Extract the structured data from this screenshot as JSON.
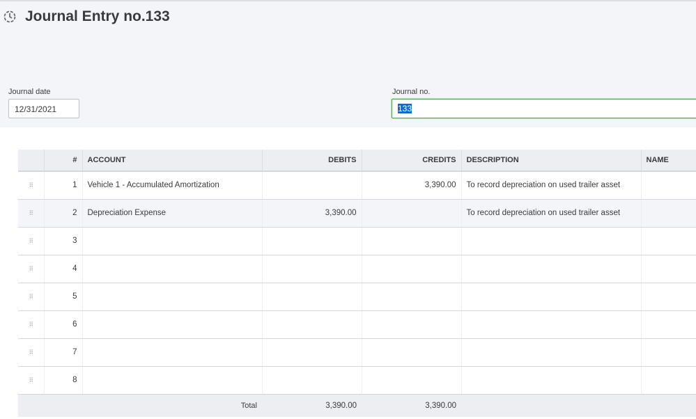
{
  "header": {
    "title": "Journal Entry no.133"
  },
  "form": {
    "date_label": "Journal date",
    "date_value": "12/31/2021",
    "no_label": "Journal no.",
    "no_value": "133"
  },
  "table": {
    "columns": [
      "#",
      "ACCOUNT",
      "DEBITS",
      "CREDITS",
      "DESCRIPTION",
      "NAME"
    ],
    "rows": [
      {
        "n": "1",
        "account": "Vehicle 1 - Accumulated Amortization",
        "debit": "",
        "credit": "3,390.00",
        "desc": "To record depreciation on used trailer asset",
        "name": ""
      },
      {
        "n": "2",
        "account": "Depreciation Expense",
        "debit": "3,390.00",
        "credit": "",
        "desc": "To record depreciation on used trailer asset",
        "name": ""
      },
      {
        "n": "3",
        "account": "",
        "debit": "",
        "credit": "",
        "desc": "",
        "name": ""
      },
      {
        "n": "4",
        "account": "",
        "debit": "",
        "credit": "",
        "desc": "",
        "name": ""
      },
      {
        "n": "5",
        "account": "",
        "debit": "",
        "credit": "",
        "desc": "",
        "name": ""
      },
      {
        "n": "6",
        "account": "",
        "debit": "",
        "credit": "",
        "desc": "",
        "name": ""
      },
      {
        "n": "7",
        "account": "",
        "debit": "",
        "credit": "",
        "desc": "",
        "name": ""
      },
      {
        "n": "8",
        "account": "",
        "debit": "",
        "credit": "",
        "desc": "",
        "name": ""
      }
    ],
    "total_label": "Total",
    "total_debits": "3,390.00",
    "total_credits": "3,390.00"
  }
}
